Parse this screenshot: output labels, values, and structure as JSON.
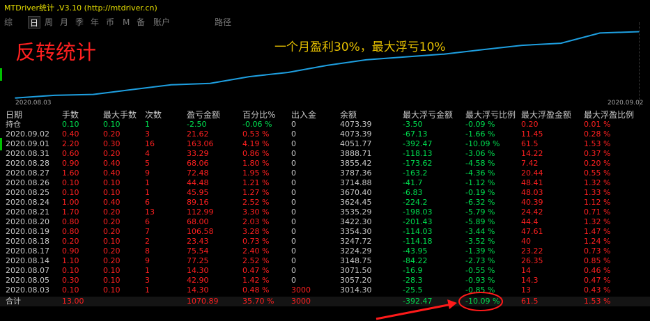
{
  "app_title": "MTDriver统计 ,V3.10 (http://mtdriver.cn)",
  "tabs": [
    "综",
    "日",
    "周",
    "月",
    "季",
    "年",
    "币",
    "M",
    "备",
    "账户",
    "路径"
  ],
  "active_tab": "日",
  "chart": {
    "title": "反转统计",
    "note": "一个月盈利30%，最大浮亏10%",
    "start_date": "2020.08.03",
    "end_date": "2020.09.02",
    "line_color": "#1e9fe0"
  },
  "chart_data": {
    "type": "line",
    "title": "",
    "x": [
      "2020.08.03",
      "2020.08.05",
      "2020.08.07",
      "2020.08.14",
      "2020.08.17",
      "2020.08.18",
      "2020.08.19",
      "2020.08.20",
      "2020.08.21",
      "2020.08.24",
      "2020.08.25",
      "2020.08.26",
      "2020.08.27",
      "2020.08.28",
      "2020.08.31",
      "2020.09.01",
      "2020.09.02"
    ],
    "series": [
      {
        "values": [
          3014.3,
          3057.2,
          3071.5,
          3148.75,
          3224.29,
          3247.72,
          3354.3,
          3422.3,
          3535.29,
          3624.45,
          3670.4,
          3714.88,
          3787.36,
          3855.42,
          3888.71,
          4051.77,
          4073.39
        ]
      }
    ],
    "xlabel": "",
    "ylabel": ""
  },
  "table": {
    "headers": [
      "日期",
      "手数",
      "最大手数",
      "次数",
      "盈亏金额",
      "百分比%",
      "出入金",
      "余额",
      "最大浮亏金额",
      "最大浮亏比例",
      "最大浮盈金额",
      "最大浮盈比例"
    ],
    "holding": [
      "持仓",
      "0.10",
      "0.10",
      "1",
      "-2.50",
      "-0.06 %",
      "0",
      "4073.39",
      "-3.50",
      "-0.09 %",
      "0.20",
      "0.01 %"
    ],
    "rows": [
      [
        "2020.09.02",
        "0.40",
        "0.20",
        "3",
        "21.62",
        "0.53 %",
        "0",
        "4073.39",
        "-67.13",
        "-1.66 %",
        "11.45",
        "0.28 %"
      ],
      [
        "2020.09.01",
        "2.20",
        "0.30",
        "16",
        "163.06",
        "4.19 %",
        "0",
        "4051.77",
        "-392.47",
        "-10.09 %",
        "61.5",
        "1.53 %"
      ],
      [
        "2020.08.31",
        "0.60",
        "0.20",
        "4",
        "33.29",
        "0.86 %",
        "0",
        "3888.71",
        "-118.13",
        "-3.06 %",
        "14.22",
        "0.37 %"
      ],
      [
        "2020.08.28",
        "0.90",
        "0.40",
        "5",
        "68.06",
        "1.80 %",
        "0",
        "3855.42",
        "-173.62",
        "-4.58 %",
        "7.42",
        "0.20 %"
      ],
      [
        "2020.08.27",
        "1.60",
        "0.40",
        "9",
        "72.48",
        "1.95 %",
        "0",
        "3787.36",
        "-163.2",
        "-4.36 %",
        "20.44",
        "0.55 %"
      ],
      [
        "2020.08.26",
        "0.10",
        "0.10",
        "1",
        "44.48",
        "1.21 %",
        "0",
        "3714.88",
        "-41.7",
        "-1.12 %",
        "48.41",
        "1.32 %"
      ],
      [
        "2020.08.25",
        "0.10",
        "0.10",
        "1",
        "45.95",
        "1.27 %",
        "0",
        "3670.40",
        "-6.83",
        "-0.19 %",
        "48.03",
        "1.33 %"
      ],
      [
        "2020.08.24",
        "1.00",
        "0.40",
        "6",
        "89.16",
        "2.52 %",
        "0",
        "3624.45",
        "-224.2",
        "-6.32 %",
        "40.39",
        "1.12 %"
      ],
      [
        "2020.08.21",
        "1.70",
        "0.20",
        "13",
        "112.99",
        "3.30 %",
        "0",
        "3535.29",
        "-198.03",
        "-5.79 %",
        "24.42",
        "0.71 %"
      ],
      [
        "2020.08.20",
        "0.80",
        "0.20",
        "6",
        "68.00",
        "2.03 %",
        "0",
        "3422.30",
        "-201.43",
        "-5.89 %",
        "44.4",
        "1.32 %"
      ],
      [
        "2020.08.19",
        "0.80",
        "0.20",
        "7",
        "106.58",
        "3.28 %",
        "0",
        "3354.30",
        "-114.03",
        "-3.44 %",
        "47.61",
        "1.47 %"
      ],
      [
        "2020.08.18",
        "0.20",
        "0.10",
        "2",
        "23.43",
        "0.73 %",
        "0",
        "3247.72",
        "-114.18",
        "-3.52 %",
        "40",
        "1.24 %"
      ],
      [
        "2020.08.17",
        "0.90",
        "0.20",
        "8",
        "75.54",
        "2.40 %",
        "0",
        "3224.29",
        "-43.95",
        "-1.39 %",
        "23.22",
        "0.73 %"
      ],
      [
        "2020.08.14",
        "1.10",
        "0.20",
        "9",
        "77.25",
        "2.52 %",
        "0",
        "3148.75",
        "-84.22",
        "-2.73 %",
        "26.35",
        "0.85 %"
      ],
      [
        "2020.08.07",
        "0.10",
        "0.10",
        "1",
        "14.30",
        "0.47 %",
        "0",
        "3071.50",
        "-16.9",
        "-0.55 %",
        "14",
        "0.46 %"
      ],
      [
        "2020.08.05",
        "0.30",
        "0.10",
        "3",
        "42.90",
        "1.42 %",
        "0",
        "3057.20",
        "-28.3",
        "-0.93 %",
        "14.3",
        "0.47 %"
      ],
      [
        "2020.08.03",
        "0.10",
        "0.10",
        "1",
        "14.30",
        "0.48 %",
        "3000",
        "3014.30",
        "-25.5",
        "-0.85 %",
        "13",
        "0.43 %"
      ]
    ],
    "total": [
      "合计",
      "13.00",
      "",
      "",
      "1070.89",
      "35.70 %",
      "3000",
      "",
      "-392.47",
      "-10.09 %",
      "61.5",
      "1.53 %"
    ]
  },
  "colors": {
    "accent": "#ff2020",
    "positive": "#ff2020",
    "negative": "#00e050",
    "annotation": "#ff1a1a"
  }
}
